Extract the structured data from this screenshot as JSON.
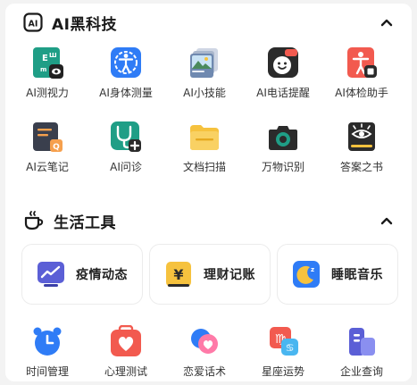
{
  "sections": {
    "ai": {
      "title": "AI黑科技",
      "items": [
        {
          "label": "AI测视力",
          "icon": "eye-chart-icon"
        },
        {
          "label": "AI身体测量",
          "icon": "body-measure-icon"
        },
        {
          "label": "AI小技能",
          "icon": "skill-cards-icon"
        },
        {
          "label": "AI电话提醒",
          "icon": "phone-remind-icon"
        },
        {
          "label": "AI体检助手",
          "icon": "health-check-icon"
        },
        {
          "label": "AI云笔记",
          "icon": "cloud-note-icon"
        },
        {
          "label": "AI问诊",
          "icon": "stethoscope-icon"
        },
        {
          "label": "文档扫描",
          "icon": "folder-scan-icon"
        },
        {
          "label": "万物识别",
          "icon": "camera-recognize-icon"
        },
        {
          "label": "答案之书",
          "icon": "answer-book-icon"
        }
      ]
    },
    "tools": {
      "title": "生活工具",
      "tiles": [
        {
          "label": "疫情动态",
          "icon": "epidemic-chart-icon"
        },
        {
          "label": "理财记账",
          "icon": "finance-yen-icon"
        },
        {
          "label": "睡眠音乐",
          "icon": "sleep-moon-icon"
        }
      ],
      "items": [
        {
          "label": "时间管理",
          "icon": "alarm-clock-icon"
        },
        {
          "label": "心理测试",
          "icon": "heart-test-icon"
        },
        {
          "label": "恋爱话术",
          "icon": "love-chat-icon"
        },
        {
          "label": "星座运势",
          "icon": "zodiac-icon"
        },
        {
          "label": "企业查询",
          "icon": "enterprise-icon"
        }
      ]
    }
  },
  "colors": {
    "accent_blue": "#2f7cf6",
    "yellow": "#f6c23e",
    "red": "#f25a4f"
  }
}
